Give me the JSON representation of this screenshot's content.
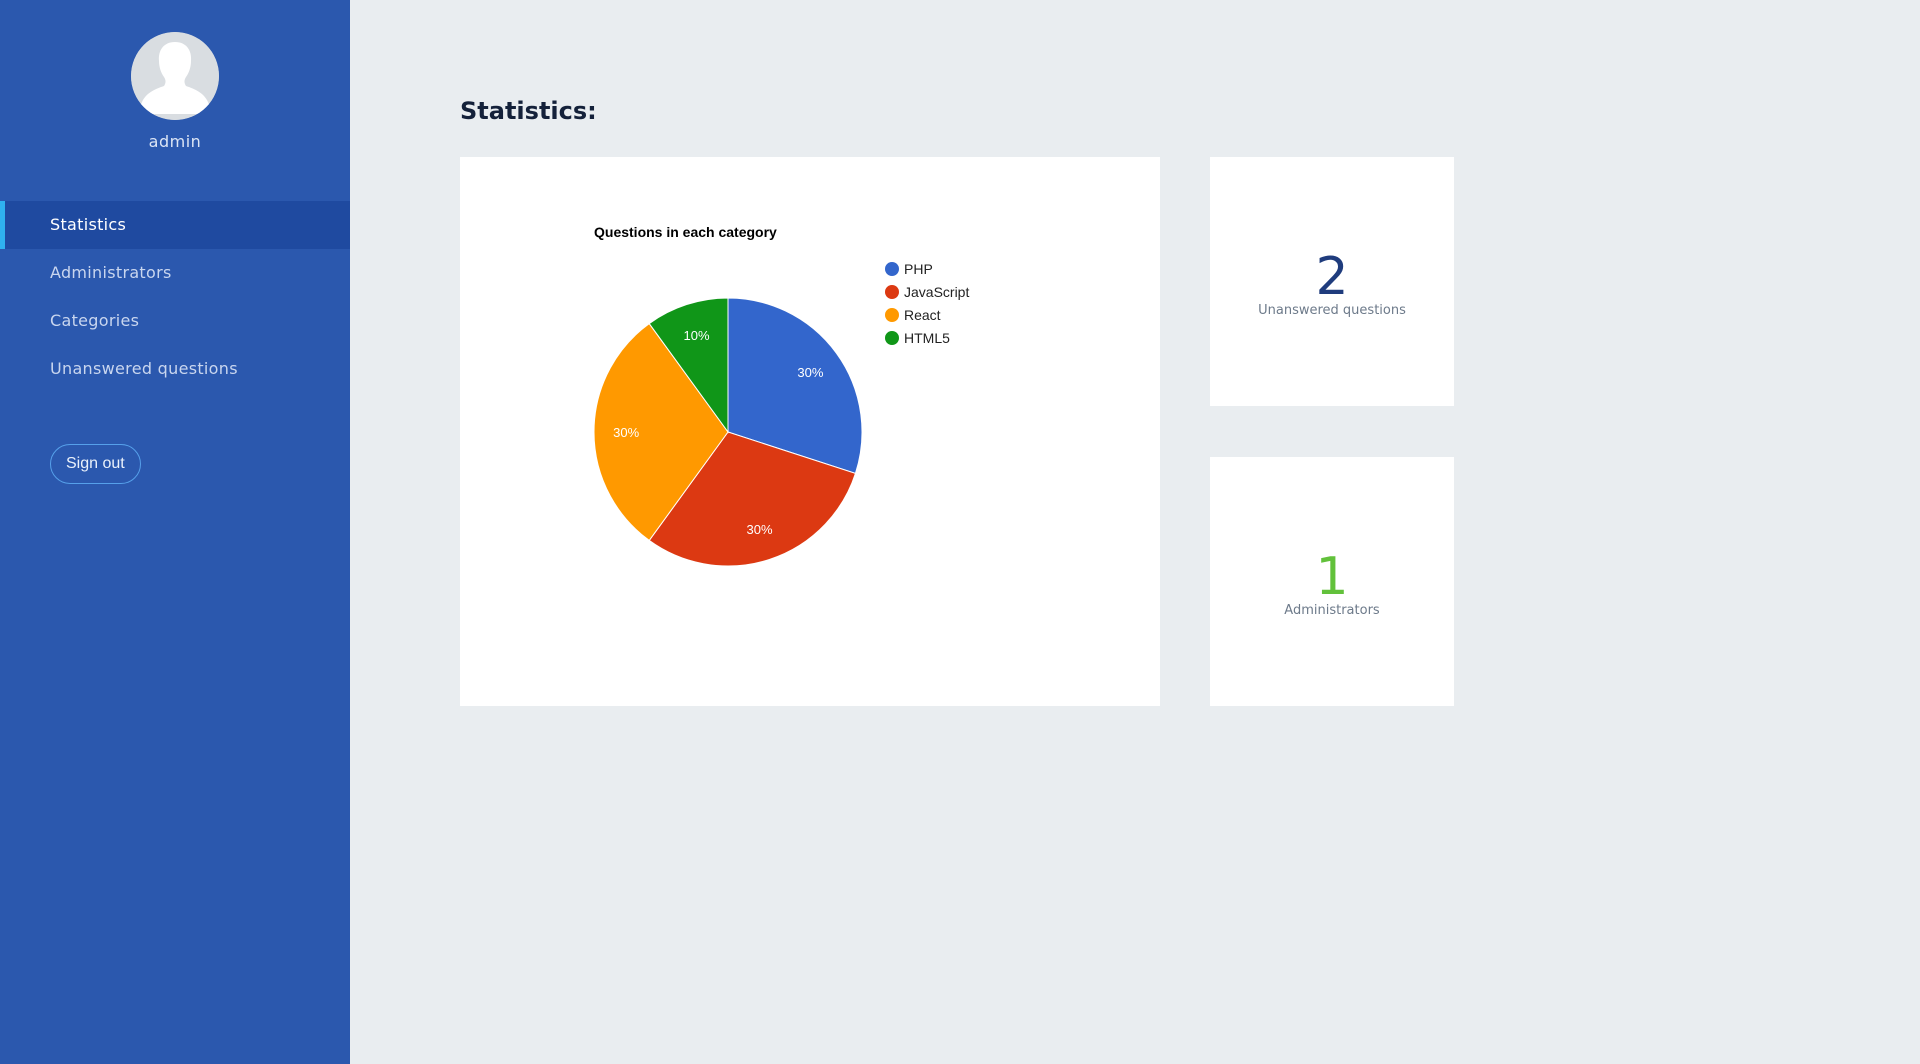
{
  "sidebar": {
    "username": "admin",
    "items": [
      {
        "label": "Statistics",
        "active": true
      },
      {
        "label": "Administrators",
        "active": false
      },
      {
        "label": "Categories",
        "active": false
      },
      {
        "label": "Unanswered questions",
        "active": false
      }
    ],
    "signout_label": "Sign out"
  },
  "main": {
    "title": "Statistics:",
    "stats": {
      "unanswered": {
        "value": "2",
        "label": "Unanswered questions"
      },
      "admins": {
        "value": "1",
        "label": "Administrators"
      }
    }
  },
  "chart_data": {
    "type": "pie",
    "title": "Questions in each category",
    "categories": [
      "PHP",
      "JavaScript",
      "React",
      "HTML5"
    ],
    "values": [
      30,
      30,
      30,
      10
    ],
    "labels": [
      "30%",
      "30%",
      "30%",
      "10%"
    ],
    "colors": [
      "#3366cc",
      "#dc3912",
      "#ff9900",
      "#109618"
    ],
    "legend": "right"
  },
  "colors": {
    "sidebar": "#2b58ae",
    "sidebar_active": "#1f4aa0",
    "active_indicator": "#2fb1ef",
    "background": "#e9edf0",
    "unanswered_number": "#1f3c7d",
    "admins_number": "#62c13b"
  }
}
